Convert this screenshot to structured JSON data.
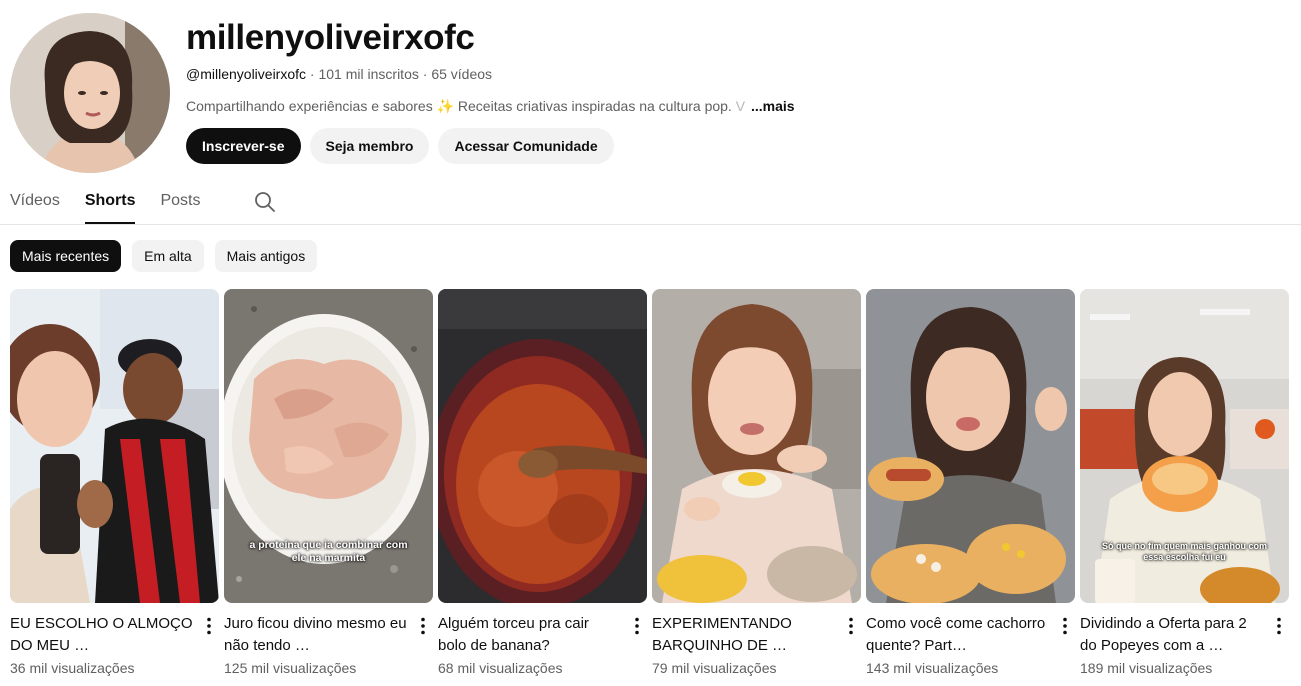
{
  "channel": {
    "name": "millenyoliveirxofc",
    "handle": "@millenyoliveirxofc",
    "subscribers": "101 mil inscritos",
    "videos": "65 vídeos",
    "separator": "·",
    "description": "Compartilhando experiências e sabores ✨ Receitas criativas inspiradas na cultura pop.",
    "description_fade": "V",
    "more_label": "...mais"
  },
  "buttons": {
    "subscribe": "Inscrever-se",
    "member": "Seja membro",
    "community": "Acessar Comunidade"
  },
  "tabs": [
    "Vídeos",
    "Shorts",
    "Posts"
  ],
  "active_tab": "Shorts",
  "chips": [
    "Mais recentes",
    "Em alta",
    "Mais antigos"
  ],
  "shorts": [
    {
      "title": "EU ESCOLHO O ALMOÇO DO MEU …",
      "views": "36 mil visualizações",
      "caption": ""
    },
    {
      "title": "Juro ficou divino mesmo eu não tendo …",
      "views": "125 mil visualizações",
      "caption": "a proteína que ia combinar com ele na marmita"
    },
    {
      "title": "Alguém torceu pra cair bolo de banana?",
      "views": "68 mil visualizações",
      "caption": ""
    },
    {
      "title": "EXPERIMENTANDO BARQUINHO DE …",
      "views": "79 mil visualizações",
      "caption": ""
    },
    {
      "title": "Como você come cachorro quente? Part…",
      "views": "143 mil visualizações",
      "caption": ""
    },
    {
      "title": "Dividindo a Oferta para 2 do Popeyes com a …",
      "views": "189 mil visualizações",
      "caption": "Só que no fim quem mais ganhou com essa escolha fui eu"
    }
  ],
  "colors": {
    "text_primary": "#0f0f0f",
    "text_secondary": "#606060",
    "chip_bg": "#f2f2f2",
    "active_bg": "#0f0f0f"
  },
  "icons": [
    "search-icon",
    "more-vert-icon"
  ]
}
